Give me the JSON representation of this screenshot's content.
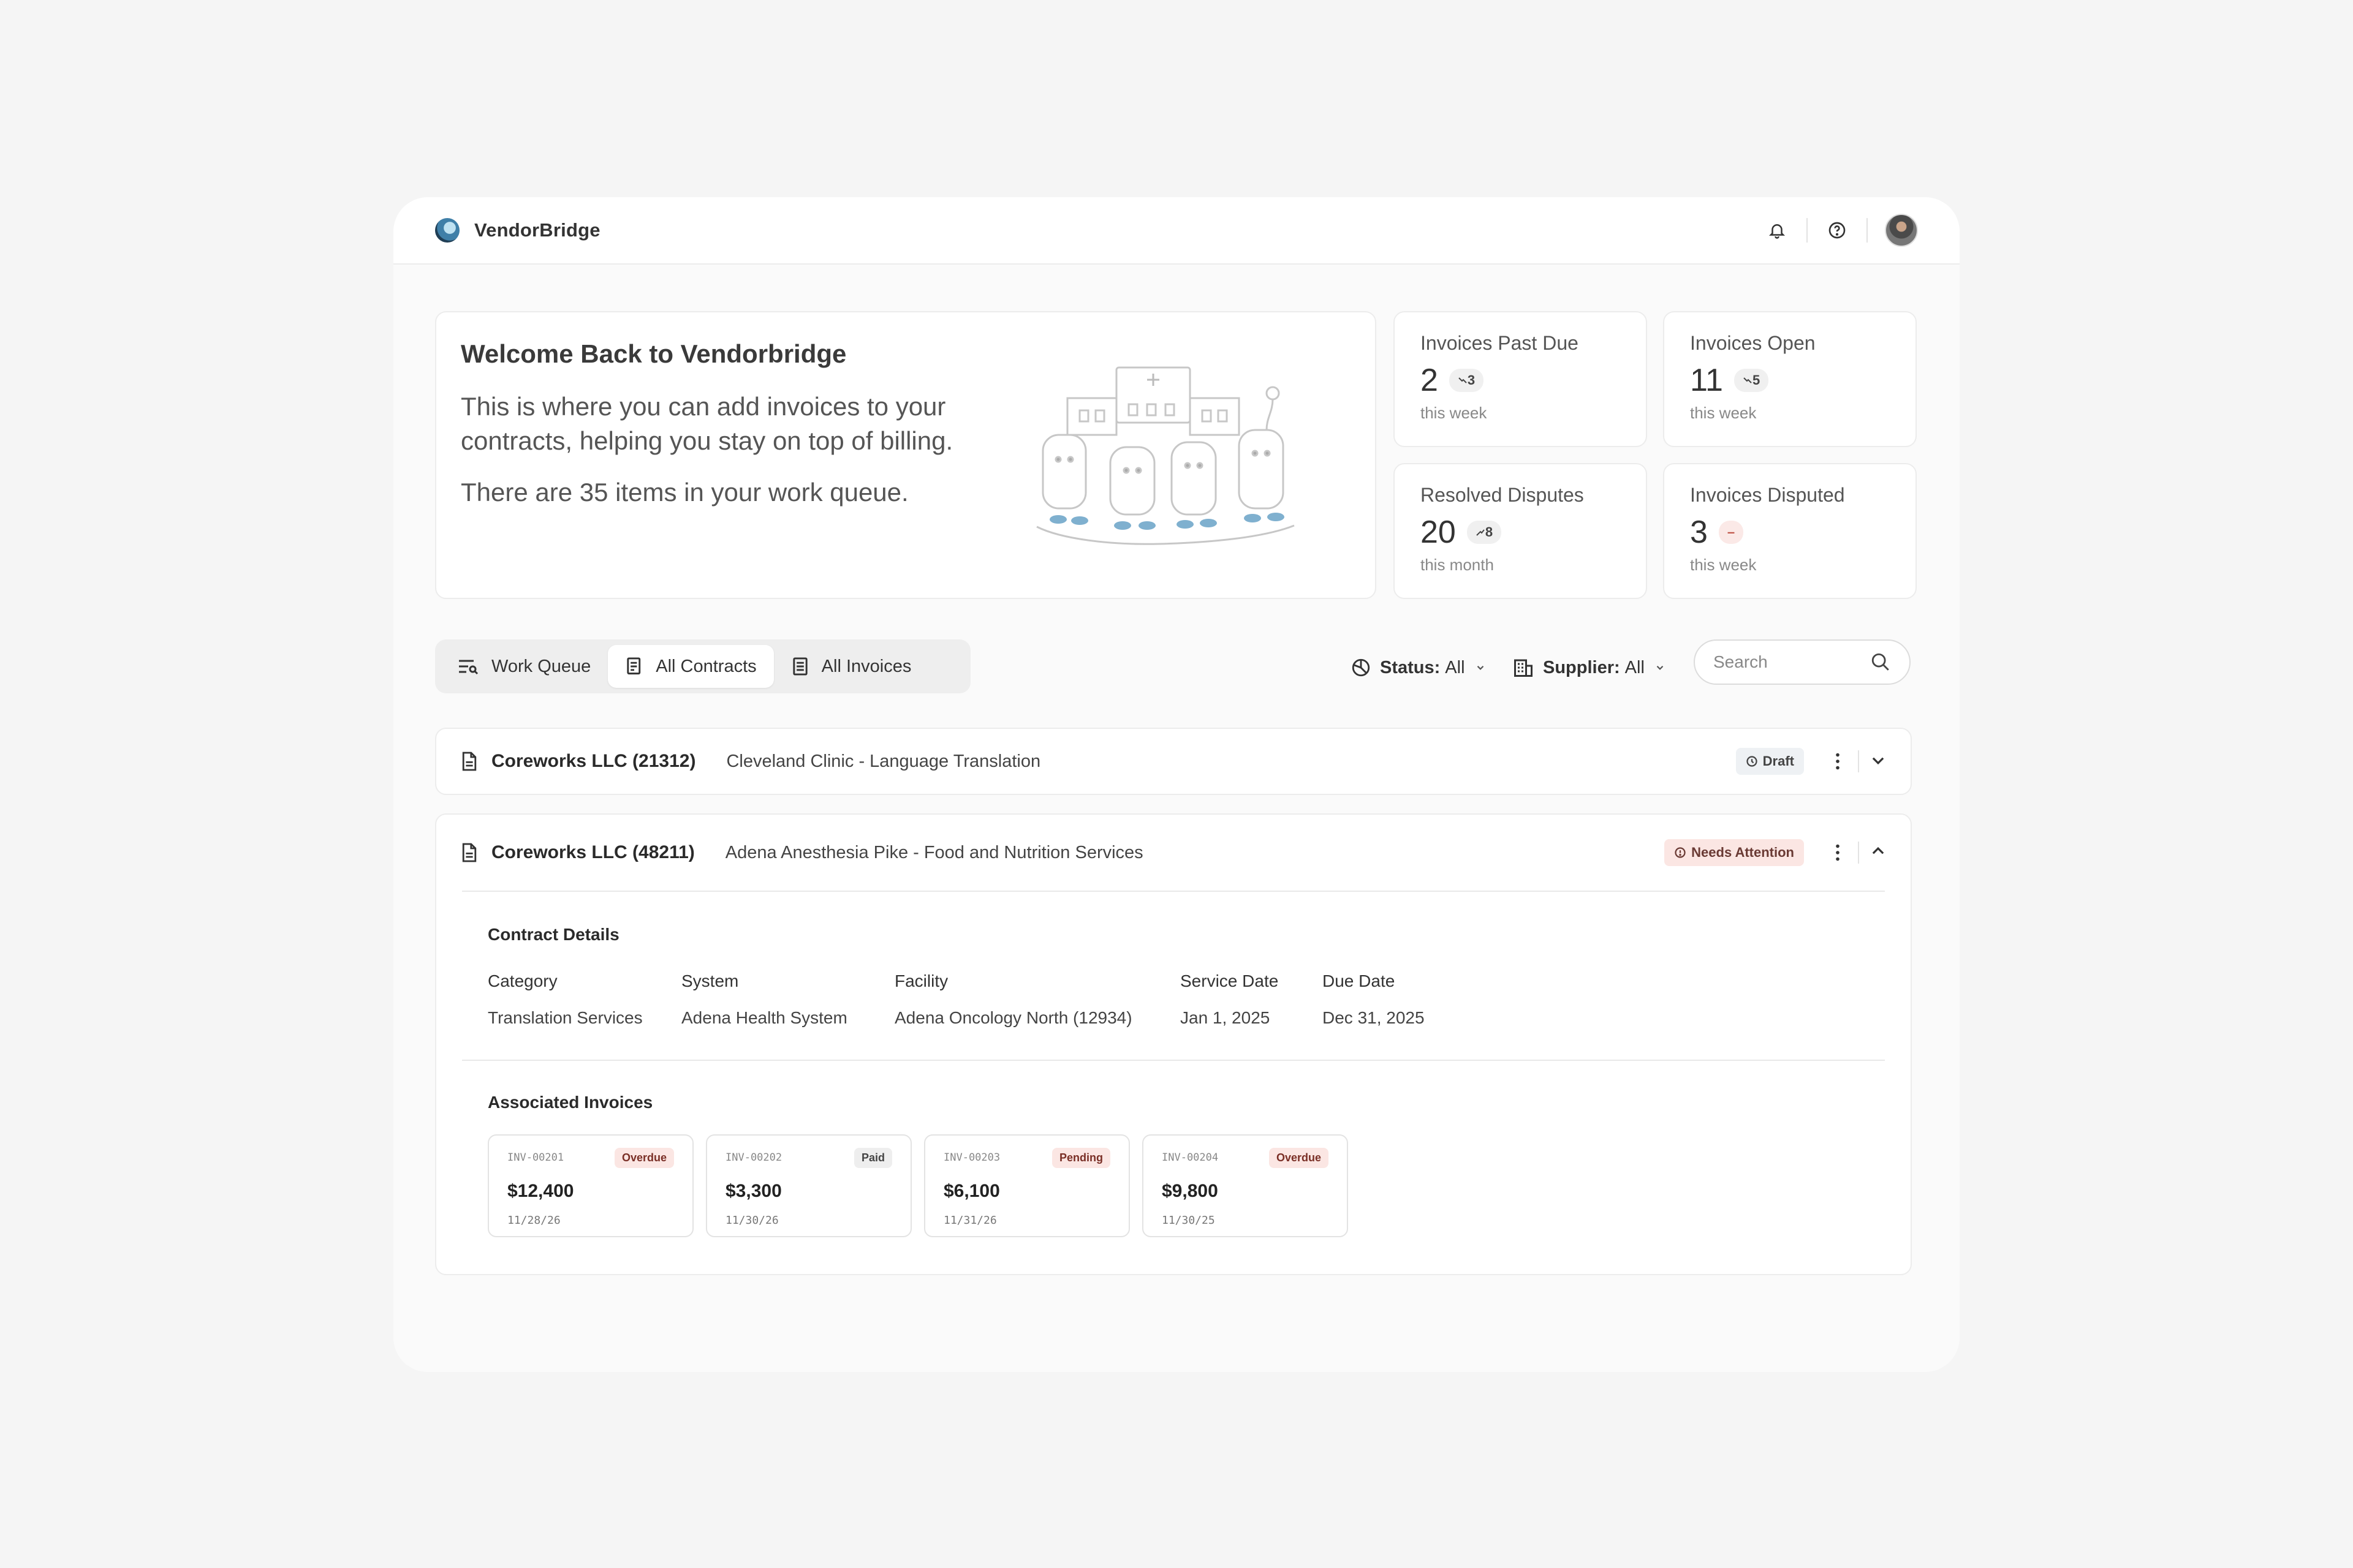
{
  "app": {
    "brand": "VendorBridge"
  },
  "welcome": {
    "title": "Welcome Back to Vendorbridge",
    "line1": "This is where you can add invoices to your contracts, helping you stay on top of billing.",
    "line2": "There are 35 items in your work queue."
  },
  "stats": [
    {
      "title": "Invoices Past Due",
      "value": "2",
      "delta": "3",
      "trend": "down",
      "period": "this week"
    },
    {
      "title": "Invoices Open",
      "value": "11",
      "delta": "5",
      "trend": "down",
      "period": "this week"
    },
    {
      "title": "Resolved Disputes",
      "value": "20",
      "delta": "8",
      "trend": "up",
      "period": "this month"
    },
    {
      "title": "Invoices Disputed",
      "value": "3",
      "delta": "–",
      "trend": "flat",
      "period": "this week"
    }
  ],
  "tabs": [
    {
      "label": "Work Queue",
      "icon": "queue-icon"
    },
    {
      "label": "All Contracts",
      "icon": "contract-icon",
      "active": true
    },
    {
      "label": "All Invoices",
      "icon": "invoice-list-icon"
    }
  ],
  "filters": {
    "status": {
      "label": "Status:",
      "value": "All"
    },
    "supplier": {
      "label": "Supplier:",
      "value": "All"
    }
  },
  "search": {
    "placeholder": "Search"
  },
  "contracts": [
    {
      "name": "Coreworks LLC (21312)",
      "description": "Cleveland Clinic - Language Translation",
      "status": "Draft",
      "expanded": false
    },
    {
      "name": "Coreworks LLC (48211)",
      "description": "Adena Anesthesia Pike - Food and Nutrition Services",
      "status": "Needs Attention",
      "expanded": true,
      "details_title": "Contract Details",
      "details": [
        {
          "label": "Category",
          "value": "Translation Services"
        },
        {
          "label": "System",
          "value": "Adena Health System"
        },
        {
          "label": "Facility",
          "value": "Adena Oncology North (12934)"
        },
        {
          "label": "Service Date",
          "value": "Jan 1, 2025"
        },
        {
          "label": "Due Date",
          "value": "Dec 31, 2025"
        }
      ],
      "invoices_title": "Associated Invoices",
      "invoices": [
        {
          "id": "INV-00201",
          "status": "Overdue",
          "amount": "$12,400",
          "date": "11/28/26"
        },
        {
          "id": "INV-00202",
          "status": "Paid",
          "amount": "$3,300",
          "date": "11/30/26"
        },
        {
          "id": "INV-00203",
          "status": "Pending",
          "amount": "$6,100",
          "date": "11/31/26"
        },
        {
          "id": "INV-00204",
          "status": "Overdue",
          "amount": "$9,800",
          "date": "11/30/25"
        }
      ]
    }
  ],
  "colors": {
    "page_bg": "#f5f5f5",
    "card_border": "#ececec",
    "attention_bg": "#fbe6e3"
  }
}
